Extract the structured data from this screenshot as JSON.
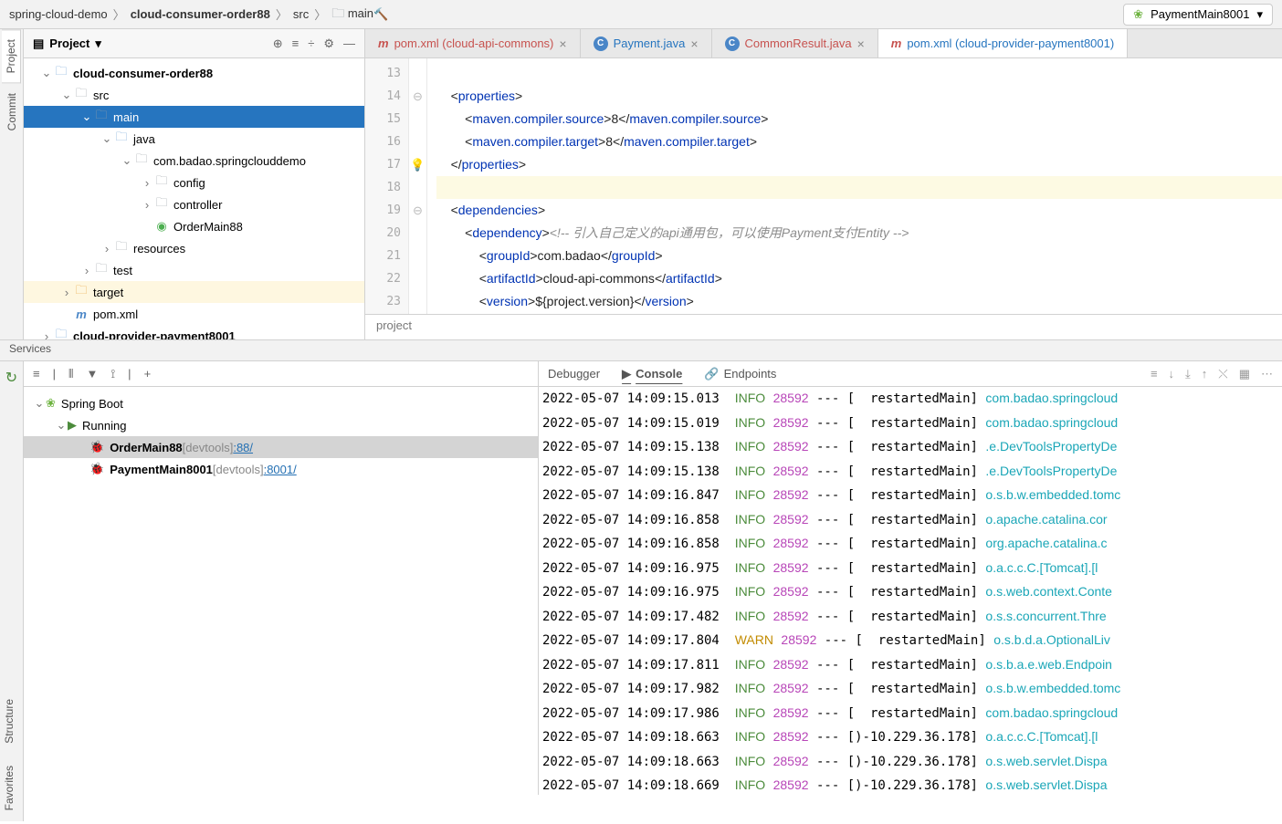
{
  "breadcrumb": [
    "spring-cloud-demo",
    "cloud-consumer-order88",
    "src",
    "main"
  ],
  "run_config": "PaymentMain8001",
  "left_tabs": [
    "Project",
    "Commit"
  ],
  "bottom_tabs": [
    "Structure",
    "Favorites"
  ],
  "project_panel": {
    "title": "Project"
  },
  "tree": [
    {
      "depth": 0,
      "arrow": "v",
      "icon": "folder-blue",
      "label": "cloud-consumer-order88",
      "bold": true
    },
    {
      "depth": 1,
      "arrow": "v",
      "icon": "folder-grey",
      "label": "src"
    },
    {
      "depth": 2,
      "arrow": "v",
      "icon": "folder-grey",
      "label": "main",
      "sel": true
    },
    {
      "depth": 3,
      "arrow": "v",
      "icon": "folder-blue",
      "label": "java"
    },
    {
      "depth": 4,
      "arrow": "v",
      "icon": "folder-grey",
      "label": "com.badao.springclouddemo"
    },
    {
      "depth": 5,
      "arrow": ">",
      "icon": "folder-grey",
      "label": "config"
    },
    {
      "depth": 5,
      "arrow": ">",
      "icon": "folder-grey",
      "label": "controller"
    },
    {
      "depth": 5,
      "arrow": "",
      "icon": "green-dot",
      "label": "OrderMain88"
    },
    {
      "depth": 3,
      "arrow": ">",
      "icon": "folder-grey",
      "label": "resources"
    },
    {
      "depth": 2,
      "arrow": ">",
      "icon": "folder-grey",
      "label": "test"
    },
    {
      "depth": 1,
      "arrow": ">",
      "icon": "folder-orange",
      "label": "target",
      "target": true
    },
    {
      "depth": 1,
      "arrow": "",
      "icon": "file-m",
      "label": "pom.xml"
    },
    {
      "depth": 0,
      "arrow": ">",
      "icon": "folder-blue",
      "label": "cloud-provider-payment8001",
      "bold": true
    }
  ],
  "tabs": [
    {
      "icon": "m",
      "label": "pom.xml (cloud-api-commons)",
      "close": true,
      "color": "#c7524f"
    },
    {
      "icon": "c",
      "label": "Payment.java",
      "close": true,
      "color": "#2675bf"
    },
    {
      "icon": "c",
      "label": "CommonResult.java",
      "close": true,
      "color": "#c7524f"
    },
    {
      "icon": "m",
      "label": "pom.xml (cloud-provider-payment8001)",
      "close": false,
      "color": "#2675bf",
      "active": true
    }
  ],
  "code_lines": [
    13,
    14,
    15,
    16,
    17,
    18,
    19,
    20,
    21,
    22,
    23
  ],
  "code": [
    "",
    "    <properties>",
    "        <maven.compiler.source>8</maven.compiler.source>",
    "        <maven.compiler.target>8</maven.compiler.target>",
    "    </properties>",
    "",
    "    <dependencies>",
    "        <dependency><!-- 引入自己定义的api通用包，可以使用Payment支付Entity -->",
    "            <groupId>com.badao</groupId>",
    "            <artifactId>cloud-api-commons</artifactId>",
    "            <version>${project.version}</version>"
  ],
  "code_hl": 5,
  "crumb": "project",
  "services_title": "Services",
  "console_tabs": [
    "Debugger",
    "Console",
    "Endpoints"
  ],
  "svc_tree": [
    {
      "depth": 0,
      "arrow": "v",
      "icon": "sb",
      "label": "Spring Boot"
    },
    {
      "depth": 1,
      "arrow": "v",
      "icon": "run",
      "label": "Running"
    },
    {
      "depth": 2,
      "arrow": "",
      "icon": "bug",
      "label": "OrderMain88",
      "dev": " [devtools] ",
      "port": ":88/",
      "sel": true,
      "bold": true
    },
    {
      "depth": 2,
      "arrow": "",
      "icon": "bug",
      "label": "PaymentMain8001",
      "dev": " [devtools] ",
      "port": ":8001/",
      "bold": true
    }
  ],
  "log": [
    {
      "ts": "2022-05-07 14:09:15.013",
      "lvl": "INFO",
      "pid": "28592",
      "th": "  restartedMain",
      "lg": "com.badao.springcloud"
    },
    {
      "ts": "2022-05-07 14:09:15.019",
      "lvl": "INFO",
      "pid": "28592",
      "th": "  restartedMain",
      "lg": "com.badao.springcloud"
    },
    {
      "ts": "2022-05-07 14:09:15.138",
      "lvl": "INFO",
      "pid": "28592",
      "th": "  restartedMain",
      "lg": ".e.DevToolsPropertyDe"
    },
    {
      "ts": "2022-05-07 14:09:15.138",
      "lvl": "INFO",
      "pid": "28592",
      "th": "  restartedMain",
      "lg": ".e.DevToolsPropertyDe"
    },
    {
      "ts": "2022-05-07 14:09:16.847",
      "lvl": "INFO",
      "pid": "28592",
      "th": "  restartedMain",
      "lg": "o.s.b.w.embedded.tomc"
    },
    {
      "ts": "2022-05-07 14:09:16.858",
      "lvl": "INFO",
      "pid": "28592",
      "th": "  restartedMain",
      "lg": "o.apache.catalina.cor"
    },
    {
      "ts": "2022-05-07 14:09:16.858",
      "lvl": "INFO",
      "pid": "28592",
      "th": "  restartedMain",
      "lg": "org.apache.catalina.c"
    },
    {
      "ts": "2022-05-07 14:09:16.975",
      "lvl": "INFO",
      "pid": "28592",
      "th": "  restartedMain",
      "lg": "o.a.c.c.C.[Tomcat].[l"
    },
    {
      "ts": "2022-05-07 14:09:16.975",
      "lvl": "INFO",
      "pid": "28592",
      "th": "  restartedMain",
      "lg": "o.s.web.context.Conte"
    },
    {
      "ts": "2022-05-07 14:09:17.482",
      "lvl": "INFO",
      "pid": "28592",
      "th": "  restartedMain",
      "lg": "o.s.s.concurrent.Thre"
    },
    {
      "ts": "2022-05-07 14:09:17.804",
      "lvl": "WARN",
      "pid": "28592",
      "th": "  restartedMain",
      "lg": "o.s.b.d.a.OptionalLiv"
    },
    {
      "ts": "2022-05-07 14:09:17.811",
      "lvl": "INFO",
      "pid": "28592",
      "th": "  restartedMain",
      "lg": "o.s.b.a.e.web.Endpoin"
    },
    {
      "ts": "2022-05-07 14:09:17.982",
      "lvl": "INFO",
      "pid": "28592",
      "th": "  restartedMain",
      "lg": "o.s.b.w.embedded.tomc"
    },
    {
      "ts": "2022-05-07 14:09:17.986",
      "lvl": "INFO",
      "pid": "28592",
      "th": "  restartedMain",
      "lg": "com.badao.springcloud"
    },
    {
      "ts": "2022-05-07 14:09:18.663",
      "lvl": "INFO",
      "pid": "28592",
      "th": ")-10.229.36.178",
      "lg": "o.a.c.c.C.[Tomcat].[l"
    },
    {
      "ts": "2022-05-07 14:09:18.663",
      "lvl": "INFO",
      "pid": "28592",
      "th": ")-10.229.36.178",
      "lg": "o.s.web.servlet.Dispa"
    },
    {
      "ts": "2022-05-07 14:09:18.669",
      "lvl": "INFO",
      "pid": "28592",
      "th": ")-10.229.36.178",
      "lg": "o.s.web.servlet.Dispa"
    }
  ]
}
